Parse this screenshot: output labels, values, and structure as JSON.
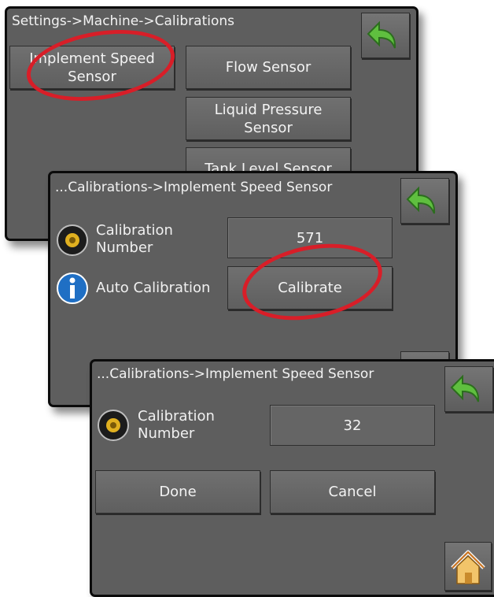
{
  "screen1": {
    "title": "Settings->Machine->Calibrations",
    "buttons": {
      "implement_speed": "Implement Speed Sensor",
      "flow": "Flow Sensor",
      "liquid_pressure": "Liquid Pressure Sensor",
      "tank_level": "Tank Level Sensor"
    }
  },
  "screen2": {
    "title": "...Calibrations->Implement Speed Sensor",
    "calibration_label": "Calibration Number",
    "calibration_value": "571",
    "auto_label": "Auto Calibration",
    "calibrate_button": "Calibrate"
  },
  "screen3": {
    "title": "...Calibrations->Implement Speed Sensor",
    "calibration_label": "Calibration Number",
    "calibration_value": "32",
    "done_button": "Done",
    "cancel_button": "Cancel"
  },
  "icons": {
    "back": "back-arrow-icon",
    "sensor": "speed-sensor-icon",
    "info": "info-icon",
    "home": "home-icon"
  },
  "colors": {
    "panel": "#5e5e5e",
    "highlight": "#d81e28",
    "arrow": "#4fa83a",
    "info": "#1f6fc4",
    "sensor": "#e0b020"
  }
}
